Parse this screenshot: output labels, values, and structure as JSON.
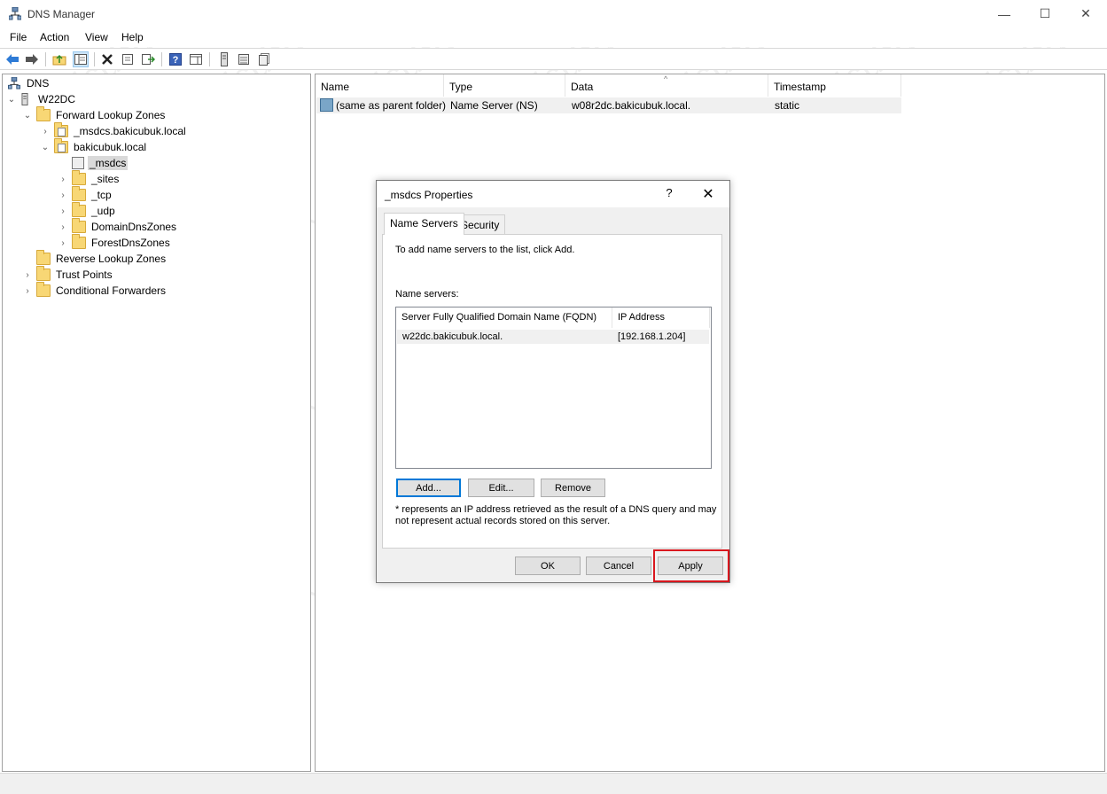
{
  "window": {
    "title": "DNS Manager",
    "min": "—",
    "max": "☐",
    "close": "✕"
  },
  "menu": [
    "File",
    "Action",
    "View",
    "Help"
  ],
  "tree": {
    "root": "DNS",
    "server": "W22DC",
    "forward_zones": "Forward Lookup Zones",
    "msdcs_zone": "_msdcs.bakicubuk.local",
    "domain_zone": "bakicubuk.local",
    "children": [
      "_msdcs",
      "_sites",
      "_tcp",
      "_udp",
      "DomainDnsZones",
      "ForestDnsZones"
    ],
    "reverse_zones": "Reverse Lookup Zones",
    "trust_points": "Trust Points",
    "conditional_forwarders": "Conditional Forwarders"
  },
  "list": {
    "columns": [
      "Name",
      "Type",
      "Data",
      "Timestamp"
    ],
    "rows": [
      {
        "name": "(same as parent folder)",
        "type": "Name Server (NS)",
        "data": "w08r2dc.bakicubuk.local.",
        "timestamp": "static"
      }
    ]
  },
  "dialog": {
    "title": "_msdcs Properties",
    "help": "?",
    "close": "✕",
    "tabs": [
      "Name Servers",
      "Security"
    ],
    "instruction": "To add name servers to the list, click Add.",
    "name_servers_label": "Name servers:",
    "columns": [
      "Server Fully Qualified Domain Name (FQDN)",
      "IP Address"
    ],
    "servers": [
      {
        "fqdn": "w22dc.bakicubuk.local.",
        "ip": "[192.168.1.204]"
      }
    ],
    "buttons": {
      "add": "Add...",
      "edit": "Edit...",
      "remove": "Remove",
      "ok": "OK",
      "cancel": "Cancel",
      "apply": "Apply"
    },
    "note_line1": "* represents an IP address retrieved as the result of a DNS query and may",
    "note_line2": "not represent actual records stored on this server."
  },
  "watermark": "bakicubuk",
  "colors": {
    "highlight": "#d9171e",
    "selection": "#d9d9d9",
    "focus": "#0078d7"
  }
}
